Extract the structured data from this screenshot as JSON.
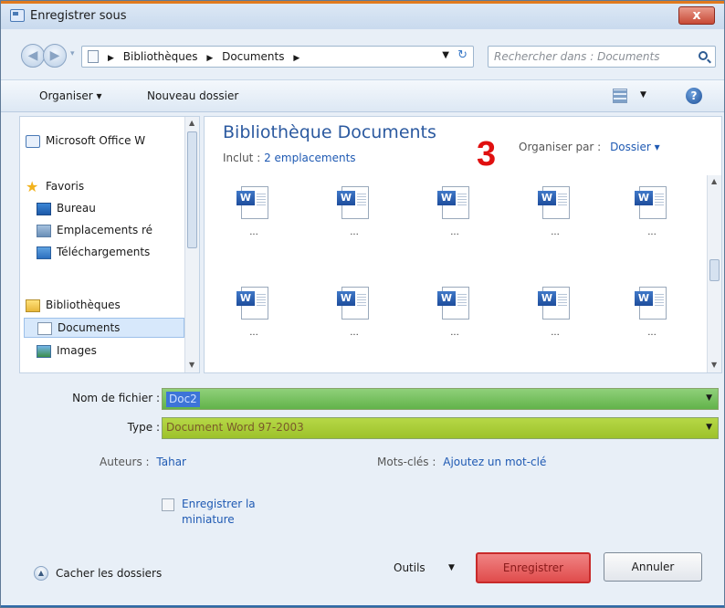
{
  "window": {
    "title": "Enregistrer sous",
    "close_label": "x"
  },
  "address": {
    "crumbs": [
      "Bibliothèques",
      "Documents"
    ],
    "search_placeholder": "Rechercher dans : Documents"
  },
  "toolbar": {
    "organiser": "Organiser ▾",
    "nouveau_dossier": "Nouveau dossier",
    "help_label": "?"
  },
  "sidebar": {
    "items": [
      {
        "label": "Microsoft Office W",
        "icon": "word-icon"
      },
      {
        "label": "Favoris",
        "icon": "star-icon"
      },
      {
        "label": "Bureau",
        "icon": "desktop-icon"
      },
      {
        "label": "Emplacements ré",
        "icon": "places-icon"
      },
      {
        "label": "Téléchargements",
        "icon": "downloads-icon"
      },
      {
        "label": "Bibliothèques",
        "icon": "library-icon"
      },
      {
        "label": "Documents",
        "icon": "documents-icon"
      },
      {
        "label": "Images",
        "icon": "images-icon"
      }
    ]
  },
  "main": {
    "library_title": "Bibliothèque Documents",
    "includes_prefix": "Inclut :",
    "includes_link": "2 emplacements",
    "arrange_prefix": "Organiser par :",
    "arrange_value": "Dossier ▾",
    "step_number": "3",
    "files": [
      {
        "label": "...",
        "icon": "word-document-icon"
      },
      {
        "label": "...",
        "icon": "word-document-icon"
      },
      {
        "label": "...",
        "icon": "word-document-icon"
      },
      {
        "label": "...",
        "icon": "word-document-icon"
      },
      {
        "label": "...",
        "icon": "word-document-icon"
      },
      {
        "label": "...",
        "icon": "word-document-icon"
      },
      {
        "label": "...",
        "icon": "word-document-icon"
      },
      {
        "label": "...",
        "icon": "word-document-icon"
      },
      {
        "label": "...",
        "icon": "word-document-icon"
      },
      {
        "label": "...",
        "icon": "word-document-icon"
      }
    ]
  },
  "form": {
    "filename_label": "Nom de fichier :",
    "filename_value": "Doc2",
    "type_label": "Type :",
    "type_value": "Document Word 97-2003",
    "authors_label": "Auteurs :",
    "authors_value": "Tahar",
    "keywords_label": "Mots-clés :",
    "keywords_value": "Ajoutez un mot-clé",
    "thumbnail_label": "Enregistrer la miniature"
  },
  "footer": {
    "hide_folders": "Cacher les dossiers",
    "tools": "Outils",
    "save": "Enregistrer",
    "cancel": "Annuler"
  },
  "colors": {
    "library_title": "#2c5aa0",
    "step_number": "#e01010",
    "filename_field": "#62b34a",
    "type_field": "#9dc22b",
    "save_highlight": "#e04c4c"
  }
}
